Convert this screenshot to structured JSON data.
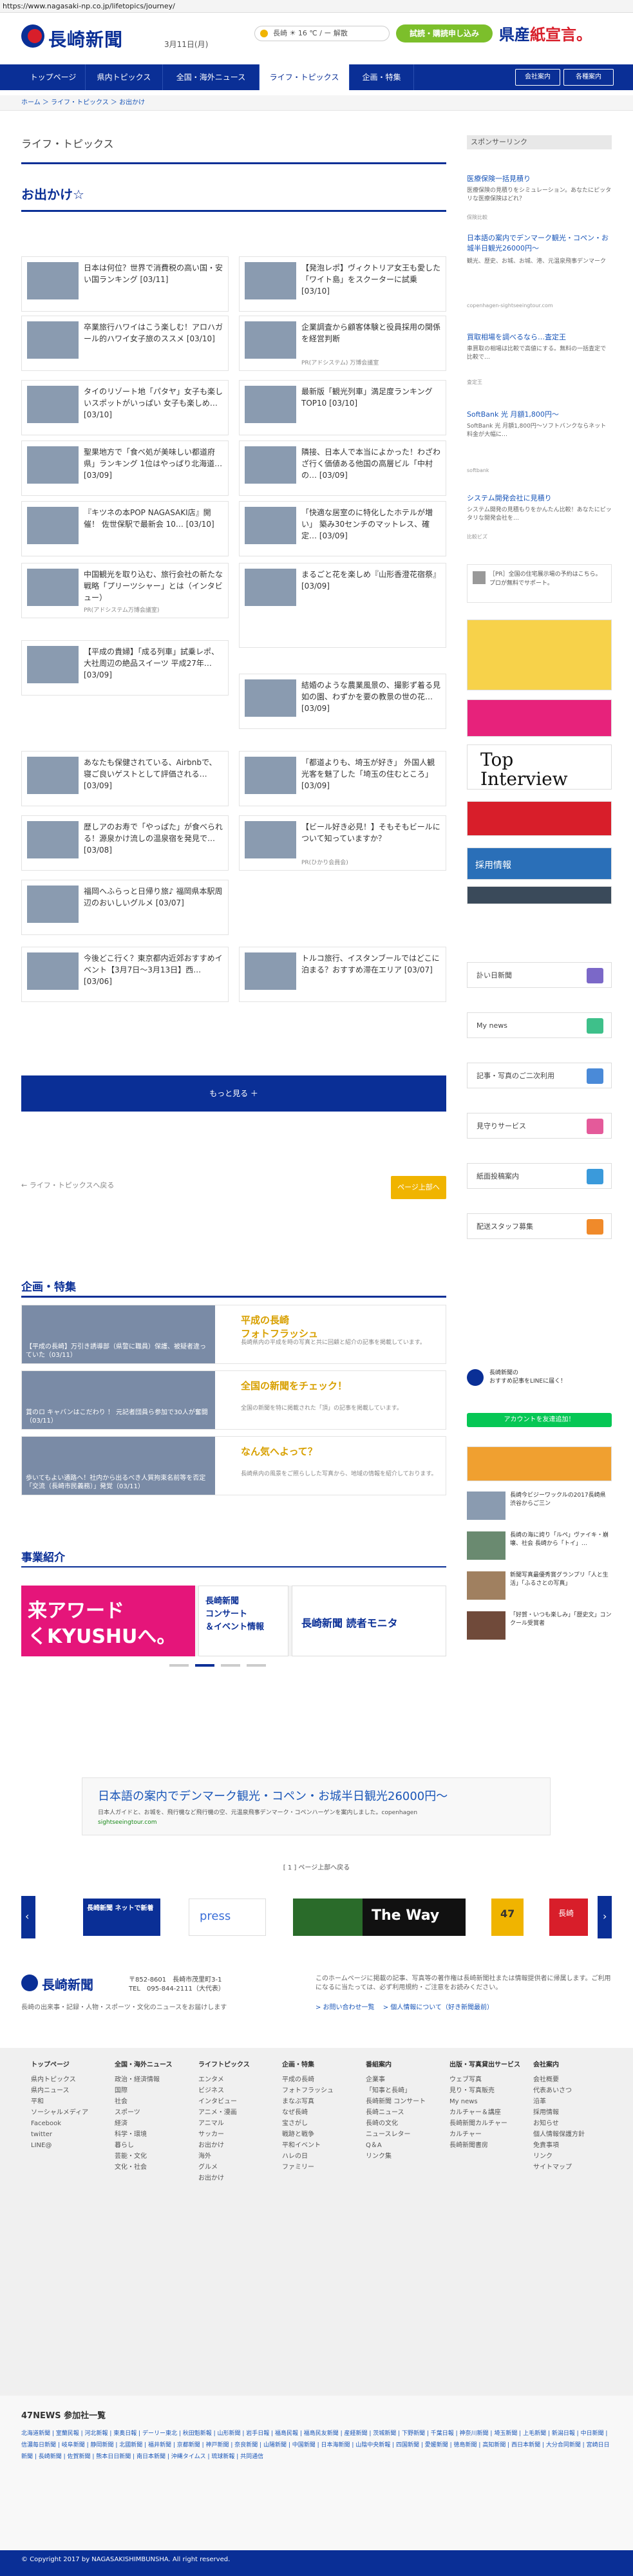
{
  "url": "https://www.nagasaki-np.co.jp/lifetopics/journey/",
  "header": {
    "logo_text": "長崎新聞",
    "date": "3月11日(月)",
    "weather": "長崎 ☀ 16 ℃ / ー 解散",
    "trial": "試読・購読申し込み",
    "banner_a": "県産",
    "banner_b": "紙宣言。"
  },
  "nav": {
    "items": [
      "トップページ",
      "県内トピックス",
      "全国・海外ニュース",
      "ライフ・トピックス",
      "企画・特集"
    ],
    "company": "会社案内",
    "ads": "各種案内"
  },
  "breadcrumb": "ホーム ＞ ライフ・トピックス ＞ お出かけ",
  "main": {
    "section": "ライフ・トピックス",
    "heading": "お出かけ☆"
  },
  "cards": [
    {
      "text": "日本は何位？世界で消費税の高い国・安い国ランキング",
      "date": "[03/11]",
      "sub": ""
    },
    {
      "text": "【発泡レポ】ヴィクトリア女王も愛した「ワイト島」をスクーターに試乗",
      "date": "[03/10]",
      "sub": ""
    },
    {
      "text": "卒業旅行ハワイはこう楽しむ！アロハガール的ハワイ女子旅のススメ",
      "date": "[03/10]",
      "sub": ""
    },
    {
      "text": "企業調査から顧客体験と役員採用の関係を経営判断",
      "date": "",
      "sub": "PR(アドシステム) 万博会議室"
    },
    {
      "text": "タイのリゾート地「パタヤ」女子も楽しいスポットがいっぱい 女子も楽しめ…",
      "date": "[03/10]",
      "sub": ""
    },
    {
      "text": "最新版「観光列車」満足度ランキングTOP10",
      "date": "[03/10]",
      "sub": ""
    },
    {
      "text": "聖果地方で「食べ処が美味しい都道府県」ランキング 1位はやっぱり北海道…",
      "date": "[03/09]",
      "sub": ""
    },
    {
      "text": "隣接、日本人で本当によかった！わざわざ行く価値ある他国の高層ビル「中村の…",
      "date": "[03/09]",
      "sub": ""
    },
    {
      "text": "『キツネの本POP NAGASAKI店』開催！ 佐世保駅で最新会 10…",
      "date": "[03/10]",
      "sub": ""
    },
    {
      "text": "「快適な居室のに特化したホテルが増い」 築み30センチのマットレス、確定…",
      "date": "[03/09]",
      "sub": ""
    },
    {
      "text": "中国観光を取り込む、旅行会社の新たな戦略「プリーツシャー」とは（インタビュー）",
      "date": "",
      "sub": "PR(アドシステム万博会議室)"
    },
    {
      "text": "まるごと花を楽しめ『山形香澄花宿祭』",
      "date": "[03/09]",
      "sub": ""
    },
    {
      "text": "【平成の貴婦】「成る列車」試乗レポ、大社周辺の絶品スイーツ 平成27年…",
      "date": "[03/09]",
      "sub": ""
    },
    {
      "text": "結婚のような農業風景の、撮影ず着る見如の園、わずかを要の教景の世の花…",
      "date": "[03/09]",
      "sub": ""
    },
    {
      "text": "あなたも保健されている、Airbnbで、寝ご良いゲストとして評価される…",
      "date": "[03/09]",
      "sub": ""
    },
    {
      "text": "「都道よりも、埼玉が好き」 外国人観光客を魅了した「埼玉の住むところ」",
      "date": "[03/09]",
      "sub": ""
    },
    {
      "text": "歴しアのお寿で「やっぱた」が食べられる！源泉かけ流しの温泉宿を発見で…",
      "date": "[03/08]",
      "sub": ""
    },
    {
      "text": "【ビール好き必見！】そもそもビールについて知っていますか？",
      "date": "",
      "sub": "PR(ひかり会員会)"
    },
    {
      "text": "福岡へふらっと日帰り旅♪ 福岡県本駅周辺のおいしいグルメ",
      "date": "[03/07]",
      "sub": ""
    },
    {
      "text": "今後どこ行く？東京都内近郊おすすめイベント【3月7日～3月13日】西…",
      "date": "[03/06]",
      "sub": ""
    },
    {
      "text": "トルコ旅行、イスタンブールではどこに泊まる？おすすめ滞在エリア",
      "date": "[03/07]",
      "sub": ""
    }
  ],
  "more_button": "もっと見る ＋",
  "back_link": "← ライフ・トピックスへ戻る",
  "top_button": "ページ上部へ",
  "projects": {
    "heading": "企画・特集",
    "items": [
      {
        "caption": "【平成の長崎】万引き誘導部（県警に職員）保護、被疑者違っていた（03/11）",
        "title": "平成の長崎\nフォトフラッシュ",
        "desc": "長崎県内の平成を時の写真と共に回顧と紹介の記事を掲載しています。"
      },
      {
        "caption": "賞のロ キャバンはこだわり ！ 元記者団員ら参加で30人が奮闘（03/11）",
        "title": "全国の新聞をチェック！",
        "desc": "全国の新聞を特に掲載された「頂」の記事を掲載しています。"
      },
      {
        "caption": "歩いてもよい通路へ！社内から出るべき人質拘束名前等を否定「交流（長崎市民義務）」発覚（03/11）",
        "title": "なん気へよって？",
        "desc": "長崎県内の風景をご照らしした写真から、地域の情報を紹介しております。"
      }
    ]
  },
  "business": {
    "heading": "事業紹介",
    "slide_a": "来アワード\nくKYUSHUへ。",
    "slide_b": "長崎新聞\nコンサート\n＆イベント情報",
    "slide_c": "長崎新聞 読者モニタ"
  },
  "ad_big": {
    "line1": "日本語の案内でデンマーク観光・コペン・お城半日観光26000円〜",
    "line2": "日本人ガイドと、お城を、飛行機など飛行機の空、元温泉飛事デンマーク・コペンハーゲンを案内しました。copenhagen",
    "line3": "sightseeingtour.com"
  },
  "paging": "[ 1 ] ページ上部へ戻る",
  "carousel": {
    "items": [
      "長崎新聞 ネットで新着",
      "press",
      "",
      "The Way",
      "47",
      "長崎"
    ]
  },
  "footer": {
    "logo": "長崎新聞",
    "addr1": "〒852-8601　長崎市茂里町3-1",
    "addr2": "TEL　095-844-2111（大代表）",
    "tag": "長崎の出来事・記録・人物・スポーツ・文化のニュースをお届けします",
    "note": "このホームページに掲載の記事、写真等の著作権は長崎新聞社または情報提供者に帰属します。ご利用になるに当たっては、必ず利用規約・ご注意をお読みください。",
    "links": "> お問い合わせ一覧　 > 個人情報について（好き新聞最前）"
  },
  "sitemap": [
    {
      "head": "トップページ",
      "items": [
        "県内トピックス",
        "県内ニュース",
        "平和",
        "",
        "ソーシャルメディア",
        "Facebook",
        "twitter",
        "LINE@"
      ]
    },
    {
      "head": "全国・海外ニュース",
      "items": [
        "政治・経済情報",
        "国際",
        "社会",
        "スポーツ",
        "経済",
        "科学・環境",
        "暮らし",
        "芸能・文化",
        "文化・社会"
      ]
    },
    {
      "head": "ライフトピックス",
      "items": [
        "エンタメ",
        "ビジネス",
        "インタビュー",
        "アニメ・漫画",
        "アニマル",
        "サッカー",
        "お出かけ",
        "海外",
        "グルメ",
        "お出かけ"
      ]
    },
    {
      "head": "企画・特集",
      "items": [
        "平成の長崎",
        "フォトフラッシュ",
        "まなぶ写真",
        "なぜ長崎",
        "宝さがし",
        "戦跡と戦争",
        "平和イベント",
        "ハレの日",
        "ファミリー"
      ]
    },
    {
      "head": "番組案内",
      "items": [
        "企業事",
        "「知事と長崎」",
        "長崎新聞 コンサート",
        "長崎ニュース",
        "長崎の文化",
        "ニュースレター",
        "Q＆A",
        "リンク集"
      ]
    },
    {
      "head": "出版・写真貸出サービス",
      "items": [
        "ウェブ写真",
        "見り・写真販売",
        "My news",
        "カルチャー＆講座",
        "長崎新聞カルチャー",
        "カルチャー",
        "長崎新聞書房"
      ]
    },
    {
      "head": "会社案内",
      "items": [
        "会社概要",
        "代表あいさつ",
        "沿革",
        "採用情報",
        "お知らせ",
        "個人情報保護方針",
        "免責事項",
        "リンク",
        "サイトマップ"
      ]
    }
  ],
  "news47": {
    "heading": "47NEWS 参加社一覧",
    "links": "北海道新聞 | 室蘭民報 | 河北新報 | 東奥日報 | デーリー東北 | 秋田魁新報 | 山形新聞 | 岩手日報 | 福島民報 | 福島民友新聞 | 産経新聞 | 茨城新聞 | 下野新聞 | 千葉日報 | 神奈川新聞 | 埼玉新聞 | 上毛新聞 | 新潟日報 | 中日新聞 | 信濃毎日新聞 | 岐阜新聞 | 静岡新聞 | 北國新聞 | 福井新聞 | 京都新聞 | 神戸新聞 | 奈良新聞 | 山陽新聞 | 中国新聞 | 日本海新聞 | 山陰中央新報 | 四国新聞 | 愛媛新聞 | 徳島新聞 | 高知新聞 | 西日本新聞 | 大分合同新聞 | 宮崎日日新聞 | 長崎新聞 | 佐賀新聞 | 熊本日日新聞 | 南日本新聞 | 沖縄タイムス | 琉球新報 | 共同通信"
  },
  "copyright": "© Copyright 2017 by NAGASAKISHIMBUNSHA. All right reserved.",
  "sidebar": {
    "head": "スポンサーリンク",
    "ads": [
      {
        "title": "医療保険一括見積り",
        "sub": "医療保険の見積りをシミュレーション。あなたにピッタリな医療保険はどれ？",
        "grey": "保険比較"
      },
      {
        "title": "日本語の案内でデンマーク観光・コペン・お城半日観光26000円〜",
        "sub": "観光、歴史、お城、お城、港、元温泉飛事デンマーク",
        "grey": "copenhagen-sightseeingtour.com"
      },
      {
        "title": "買取相場を調べるなら…査定王",
        "sub": "車買取の相場は比較で高値にする。無料の一括査定で比較で…",
        "grey": "査定王"
      },
      {
        "title": "SoftBank 光 月額1,800円～",
        "sub": "SoftBank 光 月額1,800円～ソフトバンクならネット料金が大幅に…",
        "grey": "softbank"
      },
      {
        "title": "システム開発会社に見積り",
        "sub": "システム開発の見積もりをかんたん比較！あなたにピッタリな開発会社を…",
        "grey": "比較ビズ"
      }
    ],
    "pr_note": "［PR］全国の住宅展示場の予約はこちら。プロが無料でサポート。",
    "interview_a": "Top",
    "interview_b": "Interview",
    "recruit": "採用情報",
    "buttons": [
      "訃い日新聞",
      "My news",
      "記事・写真のご二次利用",
      "見守りサービス",
      "紙面投稿案内",
      "配送スタッフ募集"
    ],
    "line_label": "長崎新聞の\nおすすめ記事をLINEに届く！",
    "line_button": "アカウントを友達追加！",
    "thumbs": [
      {
        "text": "長崎今ビジーワックルの2017長崎県　渋谷からご三ン",
        "sub": ""
      },
      {
        "text": "長崎の海に誇り「ルペ」ヴァイキ・崩壊、社会 長崎から「トイ」…",
        "sub": ""
      },
      {
        "text": "新聞写真最優秀賞グランプリ「人と生活」「ふるさとの写真」",
        "sub": ""
      },
      {
        "text": "「好賀・いつも楽しみ」「歴史文」コンクール受賞者",
        "sub": ""
      }
    ]
  }
}
